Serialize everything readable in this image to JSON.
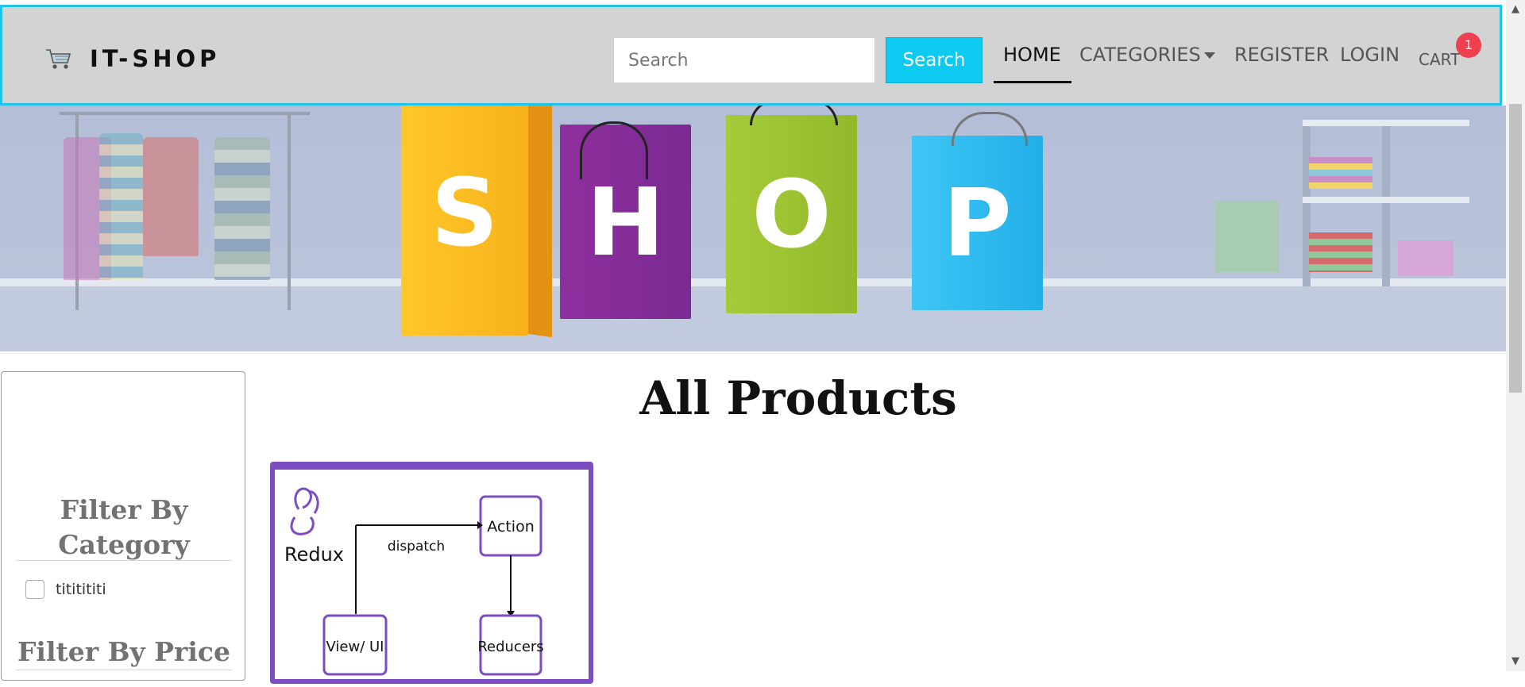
{
  "brand": {
    "name": "IT-SHOP",
    "icon": "shopping-cart-icon"
  },
  "search": {
    "placeholder": "Search",
    "button_label": "Search"
  },
  "nav": {
    "home": "HOME",
    "categories": "CATEGORIES",
    "register": "REGISTER",
    "login": "LOGIN",
    "cart": "CART",
    "cart_count": "1"
  },
  "banner": {
    "letters": [
      "S",
      "H",
      "O",
      "P"
    ]
  },
  "sidebar": {
    "category_heading": "Filter By Category",
    "categories": [
      {
        "label": "tititititi",
        "checked": false
      }
    ],
    "price_heading": "Filter By Price"
  },
  "main": {
    "title": "All Products",
    "product_image": {
      "logo_text": "Redux",
      "action": "Action",
      "dispatch": "dispatch",
      "view": "View/ UI",
      "reducers": "Reducers"
    }
  },
  "colors": {
    "accent": "#0dcaf0",
    "navbar_bg": "#d3d3d3",
    "badge": "#ef4050",
    "card_border": "#7b4dc0"
  }
}
